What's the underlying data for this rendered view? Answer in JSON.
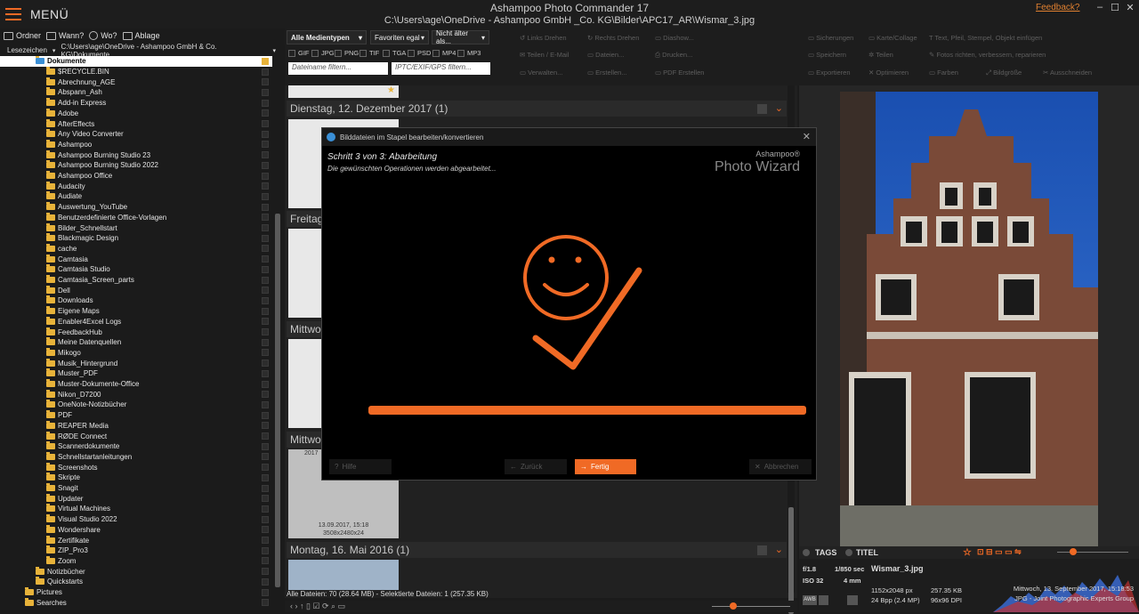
{
  "app": {
    "menu_label": "MENÜ",
    "title": "Ashampoo Photo Commander 17",
    "path": "C:\\Users\\age\\OneDrive - Ashampoo GmbH _Co. KG\\Bilder\\APC17_AR\\Wismar_3.jpg",
    "feedback": "Feedback?",
    "accent_color": "#f06a25"
  },
  "nav": {
    "folder": "Ordner",
    "when": "Wann?",
    "where": "Wo?",
    "storage": "Ablage"
  },
  "bookmarks": {
    "label": "Lesezeichen",
    "path": "C:\\Users\\age\\OneDrive - Ashampoo GmbH & Co. KG\\Dokumente"
  },
  "tree": {
    "root": "Dokumente",
    "items": [
      "$RECYCLE.BIN",
      "Abrechnung_AGE",
      "Abspann_Ash",
      "Add-in Express",
      "Adobe",
      "AfterEffects",
      "Any Video Converter",
      "Ashampoo",
      "Ashampoo Burning Studio 23",
      "Ashampoo Burning Studio 2022",
      "Ashampoo Office",
      "Audacity",
      "Audiate",
      "Auswertung_YouTube",
      "Benutzerdefinierte Office-Vorlagen",
      "Bilder_Schnellstart",
      "Blackmagic Design",
      "cache",
      "Camtasia",
      "Camtasia Studio",
      "Camtasia_Screen_parts",
      "Dell",
      "Downloads",
      "Eigene Maps",
      "Enabler4Excel Logs",
      "FeedbackHub",
      "Meine Datenquellen",
      "Mikogo",
      "Musik_Hintergrund",
      "Muster_PDF",
      "Muster-Dokumente-Office",
      "Nikon_D7200",
      "OneNote-Notizbücher",
      "PDF",
      "REAPER Media",
      "RØDE Connect",
      "Scannerdokumente",
      "Schnellstartanleitungen",
      "Screenshots",
      "Skripte",
      "Snagit",
      "Updater",
      "Virtual Machines",
      "Visual Studio 2022",
      "Wondershare",
      "Zertifikate",
      "ZIP_Pro3",
      "Zoom"
    ],
    "after": [
      "Notizbücher",
      "Quickstarts"
    ],
    "tail": [
      "Pictures",
      "Searches"
    ]
  },
  "toolbar": {
    "media_type": "Alle Medientypen",
    "favorites": "Favoriten egal",
    "age": "Nicht älter als...",
    "filetypes": [
      "GIF",
      "JPG",
      "PNG",
      "TIF",
      "TGA",
      "PSD",
      "MP4",
      "MP3"
    ],
    "filename_filter": "Dateiname filtern...",
    "iptc_filter": "IPTC/EXIF/GPS filtern...",
    "actions": {
      "rotate_left": "Links Drehen",
      "rotate_right": "Rechts Drehen",
      "slideshow": "Diashow...",
      "share": "Teilen / E-Mail",
      "files": "Dateien...",
      "print": "Drucken...",
      "manage": "Verwalten...",
      "create": "Erstellen...",
      "pdf": "PDF Erstellen",
      "backup": "Sicherungen",
      "card": "Karte/Collage",
      "text": "Text, Pfeil, Stempel, Objekt einfügen",
      "save": "Speichern",
      "share2": "Teilen",
      "fix": "Fotos richten, verbessern, reparieren",
      "export": "Exportieren",
      "optimize": "Optimieren",
      "colors": "Farben",
      "size": "Bildgröße",
      "cut": "Ausschneiden"
    }
  },
  "groups": [
    {
      "label": "Dienstag, 12. Dezember 2017 (1)"
    },
    {
      "label": "Freitag"
    },
    {
      "label": "Mittwo"
    },
    {
      "label": "Mittwo"
    },
    {
      "label": "Montag, 16. Mai 2016 (1)"
    }
  ],
  "thumb_caption": {
    "date": "13.09.2017, 15:18",
    "size": "3508x2480x24",
    "top": "2017"
  },
  "status": "Alle Dateien: 70 (28.64 MB) - Selektierte Dateien: 1 (257.35 KB)",
  "preview": {
    "tags": "TAGS",
    "title": "TITEL",
    "aperture": "f/1.8",
    "shutter": "1/850 sec",
    "iso": "ISO 32",
    "focal": "4 mm",
    "filename": "Wismar_3.jpg",
    "dimensions": "1152x2048 px",
    "filesize": "257.35 KB",
    "bpp": "24 Bpp (2.4 MP)",
    "dpi": "96x96 DPI",
    "date": "Mittwoch, 13. September 2017, 15:18:53",
    "format": "JPG - Joint Photographic Experts Group",
    "awb": "AWB"
  },
  "dialog": {
    "title": "Bilddateien im Stapel bearbeiten/konvertieren",
    "step": "Schritt 3 von 3: Abarbeitung",
    "substep": "Die gewünschten Operationen werden abgearbeitet...",
    "brand_small": "Ashampoo®",
    "brand_big": "Photo Wizard",
    "progress": 1.0,
    "help": "Hilfe",
    "back": "Zurück",
    "finish": "Fertig",
    "cancel": "Abbrechen"
  }
}
